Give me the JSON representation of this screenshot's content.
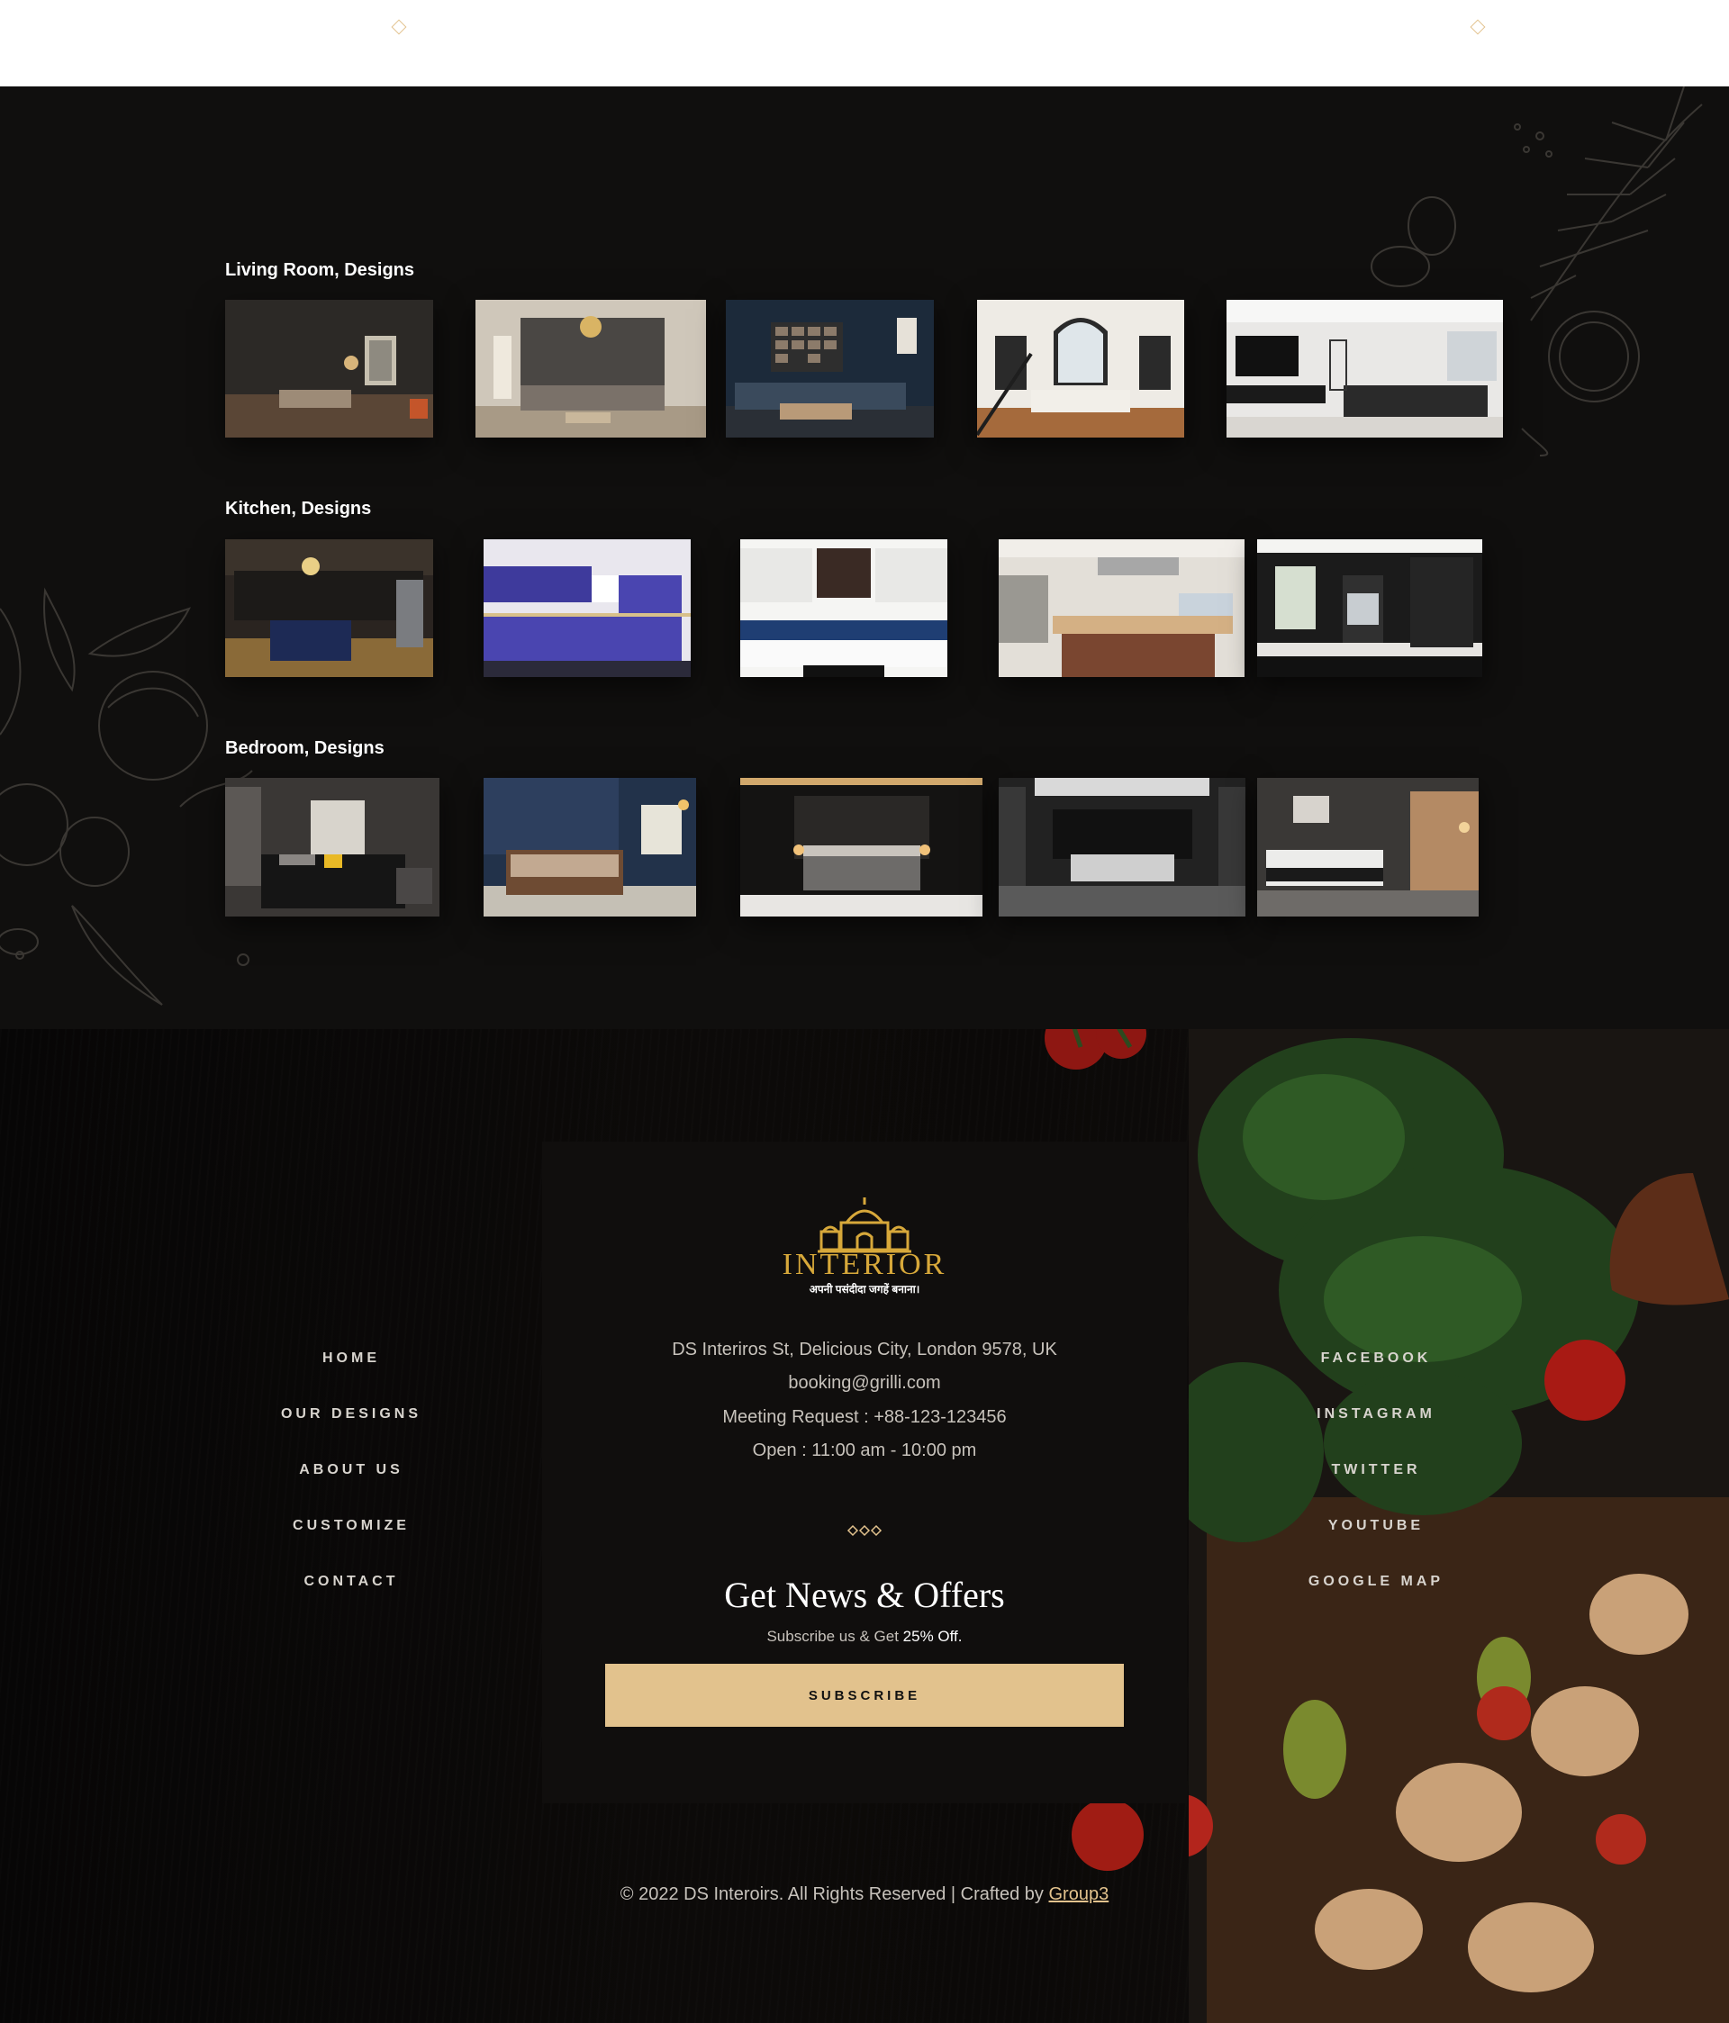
{
  "gallery": {
    "categories": [
      {
        "title": "Living Room, Designs"
      },
      {
        "title": "Kitchen, Designs"
      },
      {
        "title": "Bedroom, Designs"
      }
    ]
  },
  "footer": {
    "nav_left": [
      "HOME",
      "OUR DESIGNS",
      "ABOUT US",
      "CUSTOMIZE",
      "CONTACT"
    ],
    "nav_right": [
      "FACEBOOK",
      "INSTAGRAM",
      "TWITTER",
      "YOUTUBE",
      "GOOGLE MAP"
    ],
    "logo": {
      "name": "INTERIOR",
      "tagline": "अपनी पसंदीदा जगहें बनाना।"
    },
    "address": "DS Interiros St, Delicious City, London 9578, UK",
    "email": "booking@grilli.com",
    "phone": "Meeting Request : +88-123-123456",
    "hours": "Open : 11:00 am - 10:00 pm",
    "news_title": "Get News & Offers",
    "news_sub_prefix": "Subscribe us & Get",
    "news_sub_highlight": "25% Off.",
    "subscribe_label": "SUBSCRIBE",
    "copyright_text": "© 2022 DS Interoirs. All Rights Reserved | Crafted by",
    "copyright_link": "Group3"
  },
  "colors": {
    "accent": "#e2c28d",
    "section_bg": "#100f0e",
    "card_bg": "#100e0d"
  }
}
